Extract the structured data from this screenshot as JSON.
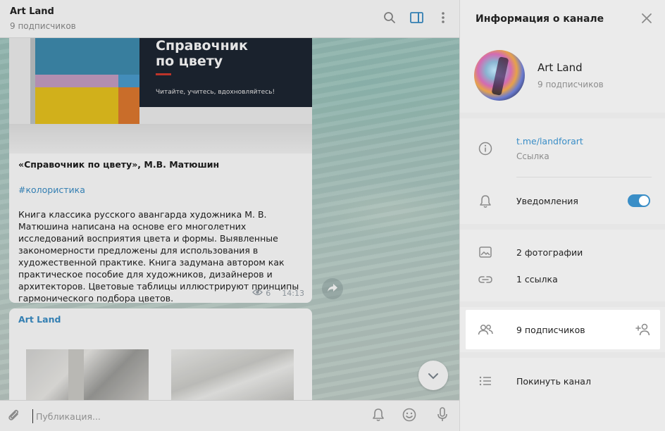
{
  "chat": {
    "title": "Art Land",
    "subtitle": "9 подписчиков",
    "header_icons": [
      "search-icon",
      "sidebar-toggle-icon",
      "more-vertical-icon"
    ],
    "post1": {
      "book_title": "Справочник\nпо цвету",
      "book_tagline": "Читайте, учитесь, вдохновляйтесь!",
      "heading": "«Справочник по цвету», М.В. Матюшин",
      "hashtag": "#колористика",
      "body": "Книга классика русского авангарда художника М. В. Матюшина написана на основе его многолетних исследований восприятия цвета и формы. Выявленные закономерности предложены для использования в художественной практике. Книга задумана автором как практическое пособие для художников, дизайнеров и архитекторов. Цветовые таблицы иллюстрируют принципы гармонического подбора цветов.",
      "views": "6",
      "time": "14:13"
    },
    "post2": {
      "author": "Art Land"
    },
    "composer": {
      "placeholder": "Публикация..."
    }
  },
  "info": {
    "title": "Информация о канале",
    "name": "Art Land",
    "subscribers": "9 подписчиков",
    "link": "t.me/landforart",
    "link_caption": "Ссылка",
    "notifications_label": "Уведомления",
    "notifications_on": true,
    "photos": "2 фотографии",
    "links": "1 ссылка",
    "members": "9 подписчиков",
    "leave": "Покинуть канал"
  },
  "colors": {
    "accent": "#3a8ec7",
    "panel_bg": "#ebebeb"
  }
}
